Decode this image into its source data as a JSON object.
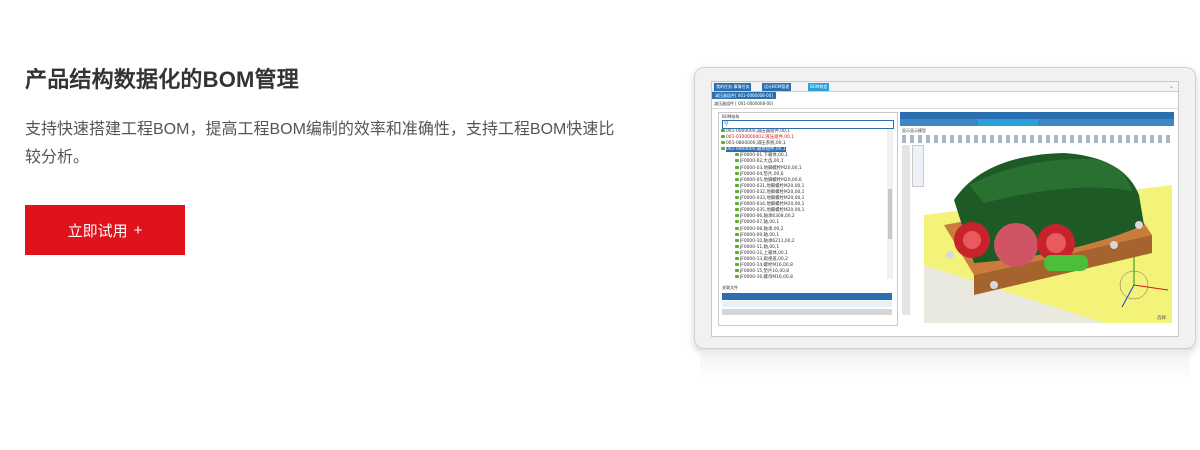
{
  "hero": {
    "title": "产品结构数据化的BOM管理",
    "description": "支持快速搭建工程BOM，提高工程BOM编制的效率和准确性，支持工程BOM快速比较分析。",
    "cta_label": "立即试用",
    "cta_icon": "+"
  },
  "screenshot": {
    "window_tabs": [
      "我的任务-事情任务",
      "设计BOM管理",
      "BOM构造"
    ],
    "sub_tab": "减压器组件[ 001-0000008-00]",
    "path": "减压器组件 [ 001-0000008-00]",
    "left_panel_title": "BOM结构",
    "tree": [
      {
        "level": 0,
        "text": "001-0000000,减压器组件,00,1",
        "style": "normal"
      },
      {
        "level": 0,
        "text": "001-0100000002,液压组件,00,1",
        "style": "red"
      },
      {
        "level": 0,
        "text": "001-0800000,减压系统,00,1",
        "style": "normal"
      },
      {
        "level": 0,
        "text": "001-0900000,箱体组件,00,1",
        "style": "selected"
      },
      {
        "level": 1,
        "text": "JF0000-01,下箱体,00,1",
        "style": "normal"
      },
      {
        "level": 1,
        "text": "JF0000-02,大齿,00,1",
        "style": "normal"
      },
      {
        "level": 1,
        "text": "JF0000-03,地脚螺栓M20,00,1",
        "style": "normal"
      },
      {
        "level": 1,
        "text": "JF0000-04,垫片,00,6",
        "style": "normal"
      },
      {
        "level": 1,
        "text": "JF0000-05,地脚螺栓M20,00,6",
        "style": "normal"
      },
      {
        "level": 1,
        "text": "JF0000-031,地脚螺栓M20,00,1",
        "style": "normal"
      },
      {
        "level": 1,
        "text": "JF0000-032,地脚螺栓M20,00,1",
        "style": "normal"
      },
      {
        "level": 1,
        "text": "JF0000-033,地脚螺栓M20,00,1",
        "style": "normal"
      },
      {
        "level": 1,
        "text": "JF0000-034,地脚螺栓M20,00,1",
        "style": "normal"
      },
      {
        "level": 1,
        "text": "JF0000-035,地脚螺栓M20,00,1",
        "style": "normal"
      },
      {
        "level": 1,
        "text": "JF0000-06,轴承6308,00,2",
        "style": "normal"
      },
      {
        "level": 1,
        "text": "JF0000-07,轴,00,1",
        "style": "normal"
      },
      {
        "level": 1,
        "text": "JF0000-08,轴承,00,2",
        "style": "normal"
      },
      {
        "level": 1,
        "text": "JF0000-09,轴,00,1",
        "style": "normal"
      },
      {
        "level": 1,
        "text": "JF0000-10,轴承6211,00,2",
        "style": "normal"
      },
      {
        "level": 1,
        "text": "JF0000-11,轴,00,1",
        "style": "normal"
      },
      {
        "level": 1,
        "text": "JF0000-12,上箱体,00,1",
        "style": "normal"
      },
      {
        "level": 1,
        "text": "JF0000-13,窥视盖,00,2",
        "style": "normal"
      },
      {
        "level": 1,
        "text": "JF0000-14,螺栓M16,00,8",
        "style": "normal"
      },
      {
        "level": 1,
        "text": "JF0000-15,垫片16,00,8",
        "style": "normal"
      },
      {
        "level": 1,
        "text": "JF0000-16,螺母M16,00,8",
        "style": "normal"
      }
    ],
    "bottom_panel_title": "关联文件",
    "right_checkbox_label": "显示显示模型",
    "status_label": "选择",
    "colors": {
      "primary_blue": "#2a6fb0",
      "accent_blue": "#2aa0dc",
      "cta_red": "#e0121b",
      "model_green": "#1e5a26",
      "model_red": "#c8222a"
    }
  }
}
